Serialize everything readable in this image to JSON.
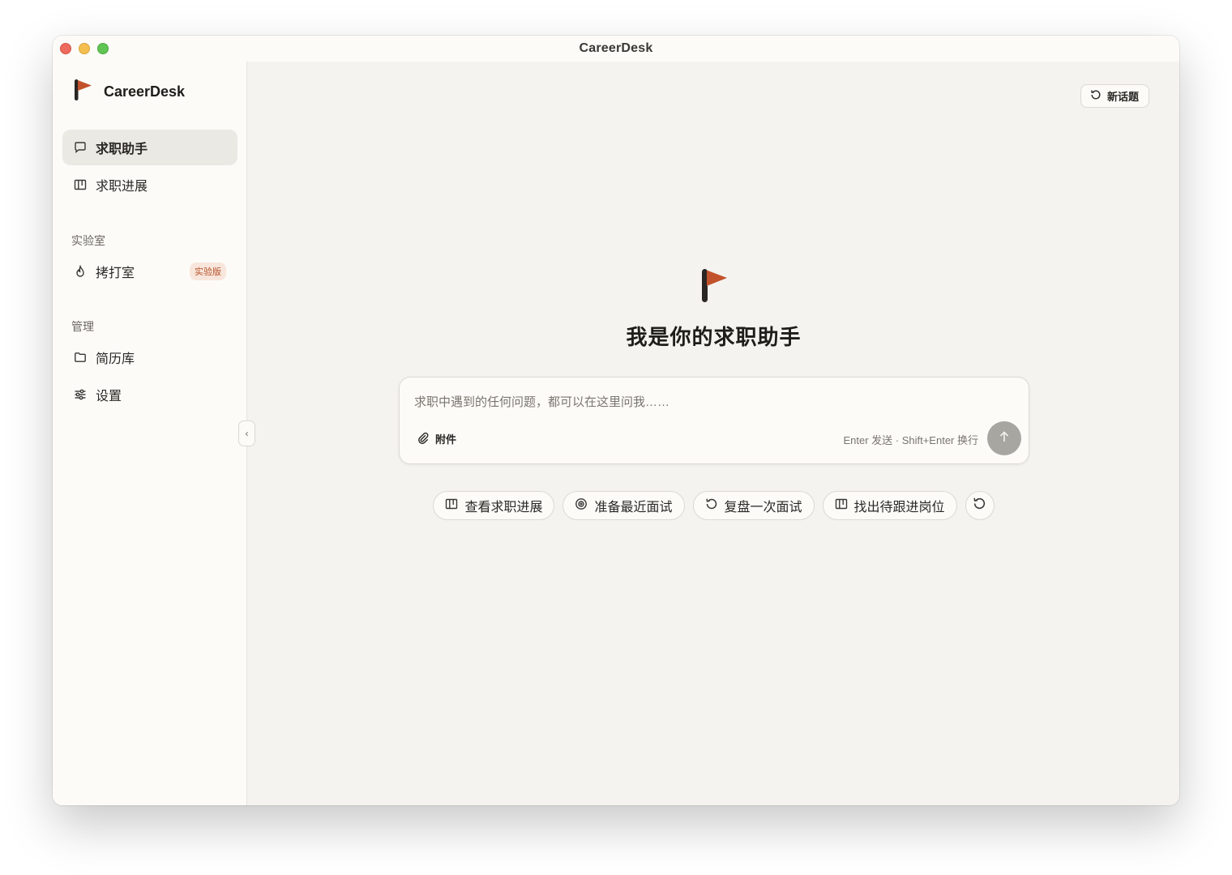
{
  "window": {
    "title": "CareerDesk"
  },
  "brand": {
    "name": "CareerDesk"
  },
  "sidebar": {
    "items": [
      {
        "label": "求职助手",
        "icon": "chat-bubble-icon",
        "active": true
      },
      {
        "label": "求职进展",
        "icon": "kanban-icon",
        "active": false
      }
    ],
    "lab": {
      "title": "实验室",
      "items": [
        {
          "label": "拷打室",
          "icon": "flame-icon",
          "badge": "实验版"
        }
      ]
    },
    "manage": {
      "title": "管理",
      "items": [
        {
          "label": "简历库",
          "icon": "folder-icon"
        },
        {
          "label": "设置",
          "icon": "sliders-icon"
        }
      ]
    }
  },
  "header": {
    "new_topic_label": "新话题"
  },
  "hero": {
    "title": "我是你的求职助手"
  },
  "composer": {
    "placeholder": "求职中遇到的任何问题，都可以在这里问我……",
    "value": "",
    "attach_label": "附件",
    "hint": "Enter 发送 · Shift+Enter 换行"
  },
  "suggestions": [
    {
      "label": "查看求职进展",
      "icon": "kanban-icon"
    },
    {
      "label": "准备最近面试",
      "icon": "target-icon"
    },
    {
      "label": "复盘一次面试",
      "icon": "rotate-icon"
    },
    {
      "label": "找出待跟进岗位",
      "icon": "kanban-icon"
    }
  ],
  "colors": {
    "accent": "#c2522b",
    "sidebar_bg": "#fcfbf8",
    "main_bg": "#f4f3ef",
    "send_disabled": "#a8a6a1"
  }
}
